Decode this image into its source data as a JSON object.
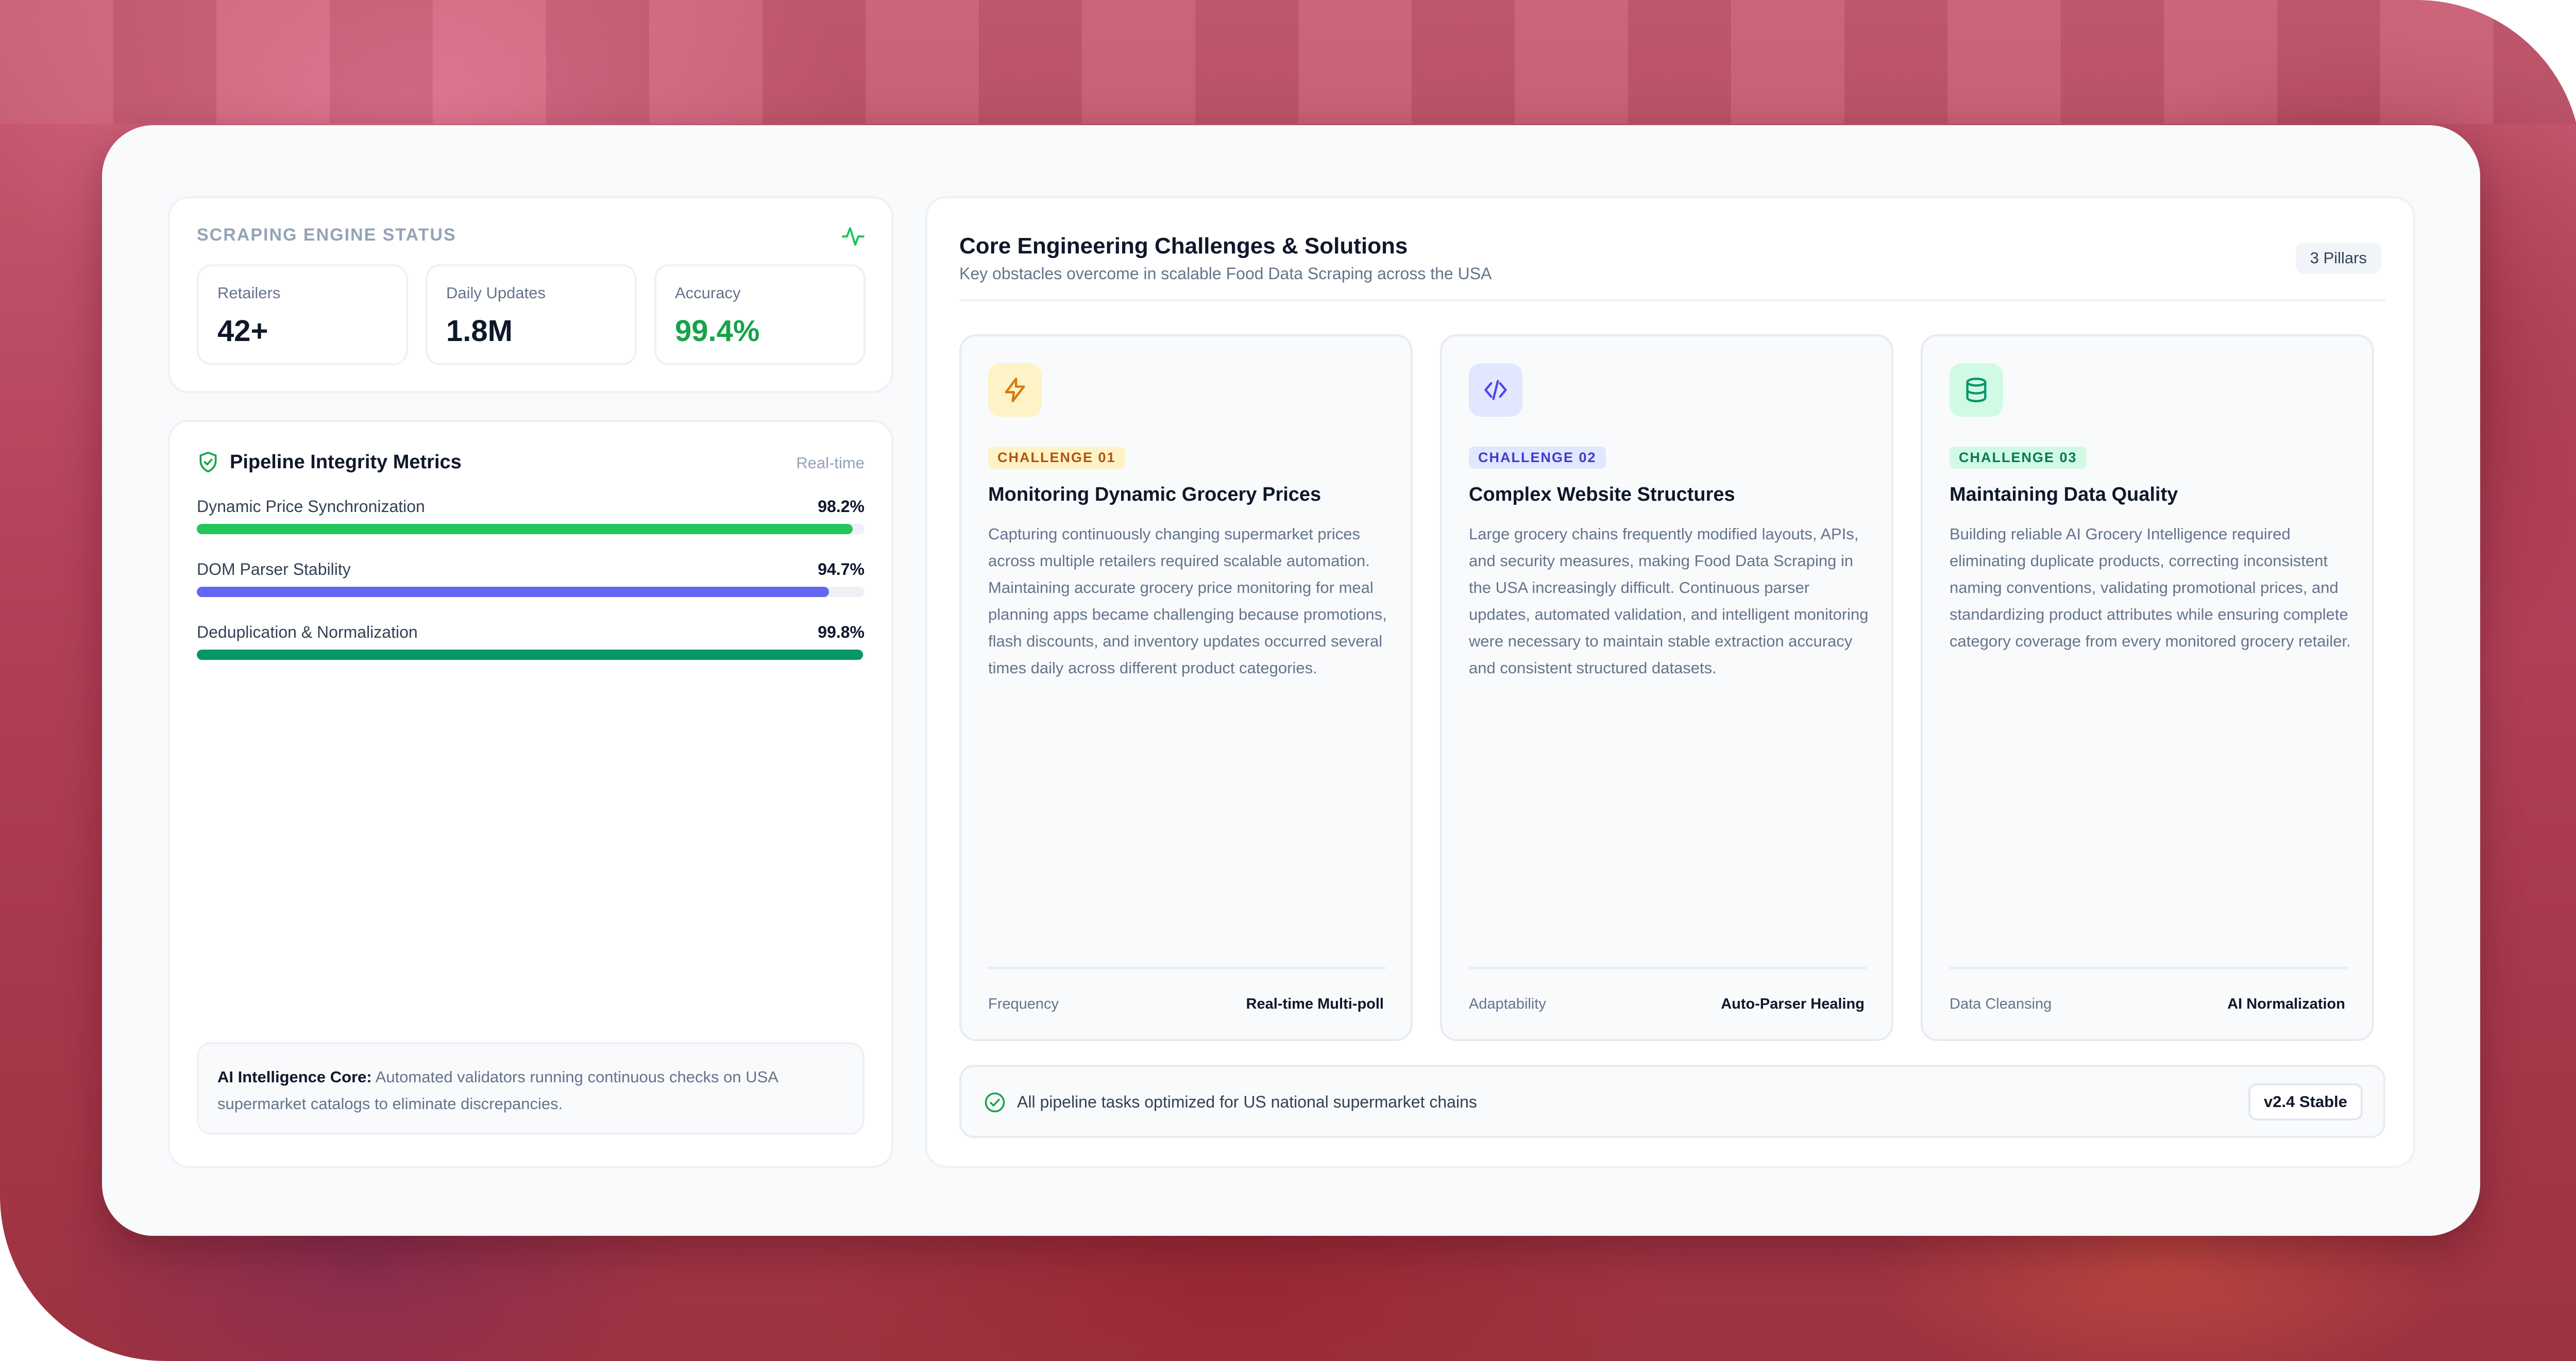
{
  "colors": {
    "green": "#22c55e",
    "indigo": "#6366f1",
    "emerald": "#059669",
    "amber": "#f59e0b",
    "accuracy": "#16a34a"
  },
  "status_panel": {
    "title": "SCRAPING ENGINE STATUS",
    "icon": "activity-pulse-icon",
    "stats": [
      {
        "label": "Retailers",
        "value": "42+"
      },
      {
        "label": "Daily Updates",
        "value": "1.8M"
      },
      {
        "label": "Accuracy",
        "value": "99.4%"
      }
    ]
  },
  "metrics_panel": {
    "title": "Pipeline Integrity Metrics",
    "icon": "shield-check-icon",
    "tag": "Real-time",
    "metrics": [
      {
        "label": "Dynamic Price Synchronization",
        "value": "98.2%",
        "fraction": 0.982,
        "color": "#22c55e"
      },
      {
        "label": "DOM Parser Stability",
        "value": "94.7%",
        "fraction": 0.947,
        "color": "#6366f1"
      },
      {
        "label": "Deduplication & Normalization",
        "value": "99.8%",
        "fraction": 0.998,
        "color": "#059669"
      }
    ],
    "note_bold": "AI Intelligence Core:",
    "note_text": " Automated validators running continuous checks on USA supermarket catalogs to eliminate discrepancies."
  },
  "main_panel": {
    "title": "Core Engineering Challenges & Solutions",
    "subtitle": "Key obstacles overcome in scalable Food Data Scraping across the USA",
    "badge": "3 Pillars",
    "challenges": [
      {
        "icon": "lightning-bolt-icon",
        "badge": "CHALLENGE 01",
        "title": "Monitoring Dynamic Grocery Prices",
        "body": "Capturing continuously changing supermarket prices across multiple retailers required scalable automation. Maintaining accurate grocery price monitoring for meal planning apps became challenging because promotions, flash discounts, and inventory updates occurred several times daily across different product categories.",
        "foot_label": "Frequency",
        "foot_value": "Real-time Multi-poll"
      },
      {
        "icon": "code-brackets-icon",
        "badge": "CHALLENGE 02",
        "title": "Complex Website Structures",
        "body": "Large grocery chains frequently modified layouts, APIs, and security measures, making Food Data Scraping in the USA increasingly difficult. Continuous parser updates, automated validation, and intelligent monitoring were necessary to maintain stable extraction accuracy and consistent structured datasets.",
        "foot_label": "Adaptability",
        "foot_value": "Auto-Parser Healing"
      },
      {
        "icon": "database-icon",
        "badge": "CHALLENGE 03",
        "title": "Maintaining Data Quality",
        "body": "Building reliable AI Grocery Intelligence required eliminating duplicate products, correcting inconsistent naming conventions, validating promotional prices, and standardizing product attributes while ensuring complete category coverage from every monitored grocery retailer.",
        "foot_label": "Data Cleansing",
        "foot_value": "AI Normalization"
      }
    ],
    "footer_text": "All pipeline tasks optimized for US national supermarket chains",
    "version": "v2.4 Stable"
  }
}
